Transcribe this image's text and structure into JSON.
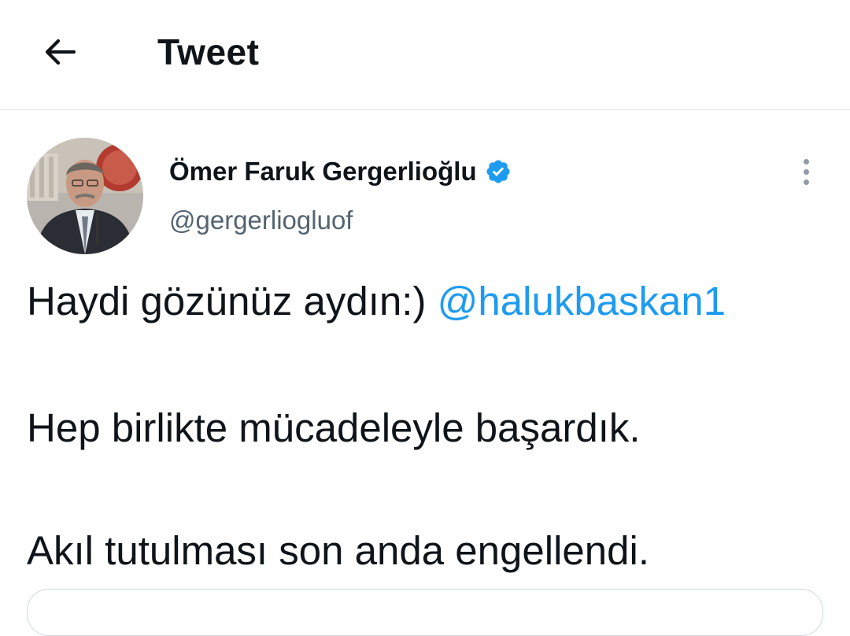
{
  "header": {
    "title": "Tweet",
    "back_icon": "arrow-left-icon"
  },
  "author": {
    "name": "Ömer Faruk Gergerlioğlu",
    "handle": "@gergerliogluof",
    "verified_icon": "verified-badge-icon",
    "verified_color": "#1d9bf0"
  },
  "tweet": {
    "line1_text": "Haydi gözünüz aydın:)",
    "mention": "@halukbaskan1",
    "line2_text": "Hep birlikte mücadeleyle başardık.",
    "line3_text": "Akıl tutulması son anda engellendi."
  },
  "more_icon": "more-vertical-icon",
  "colors": {
    "link": "#1d9bf0",
    "secondary_text": "#536471",
    "divider": "#e1e4e6"
  }
}
